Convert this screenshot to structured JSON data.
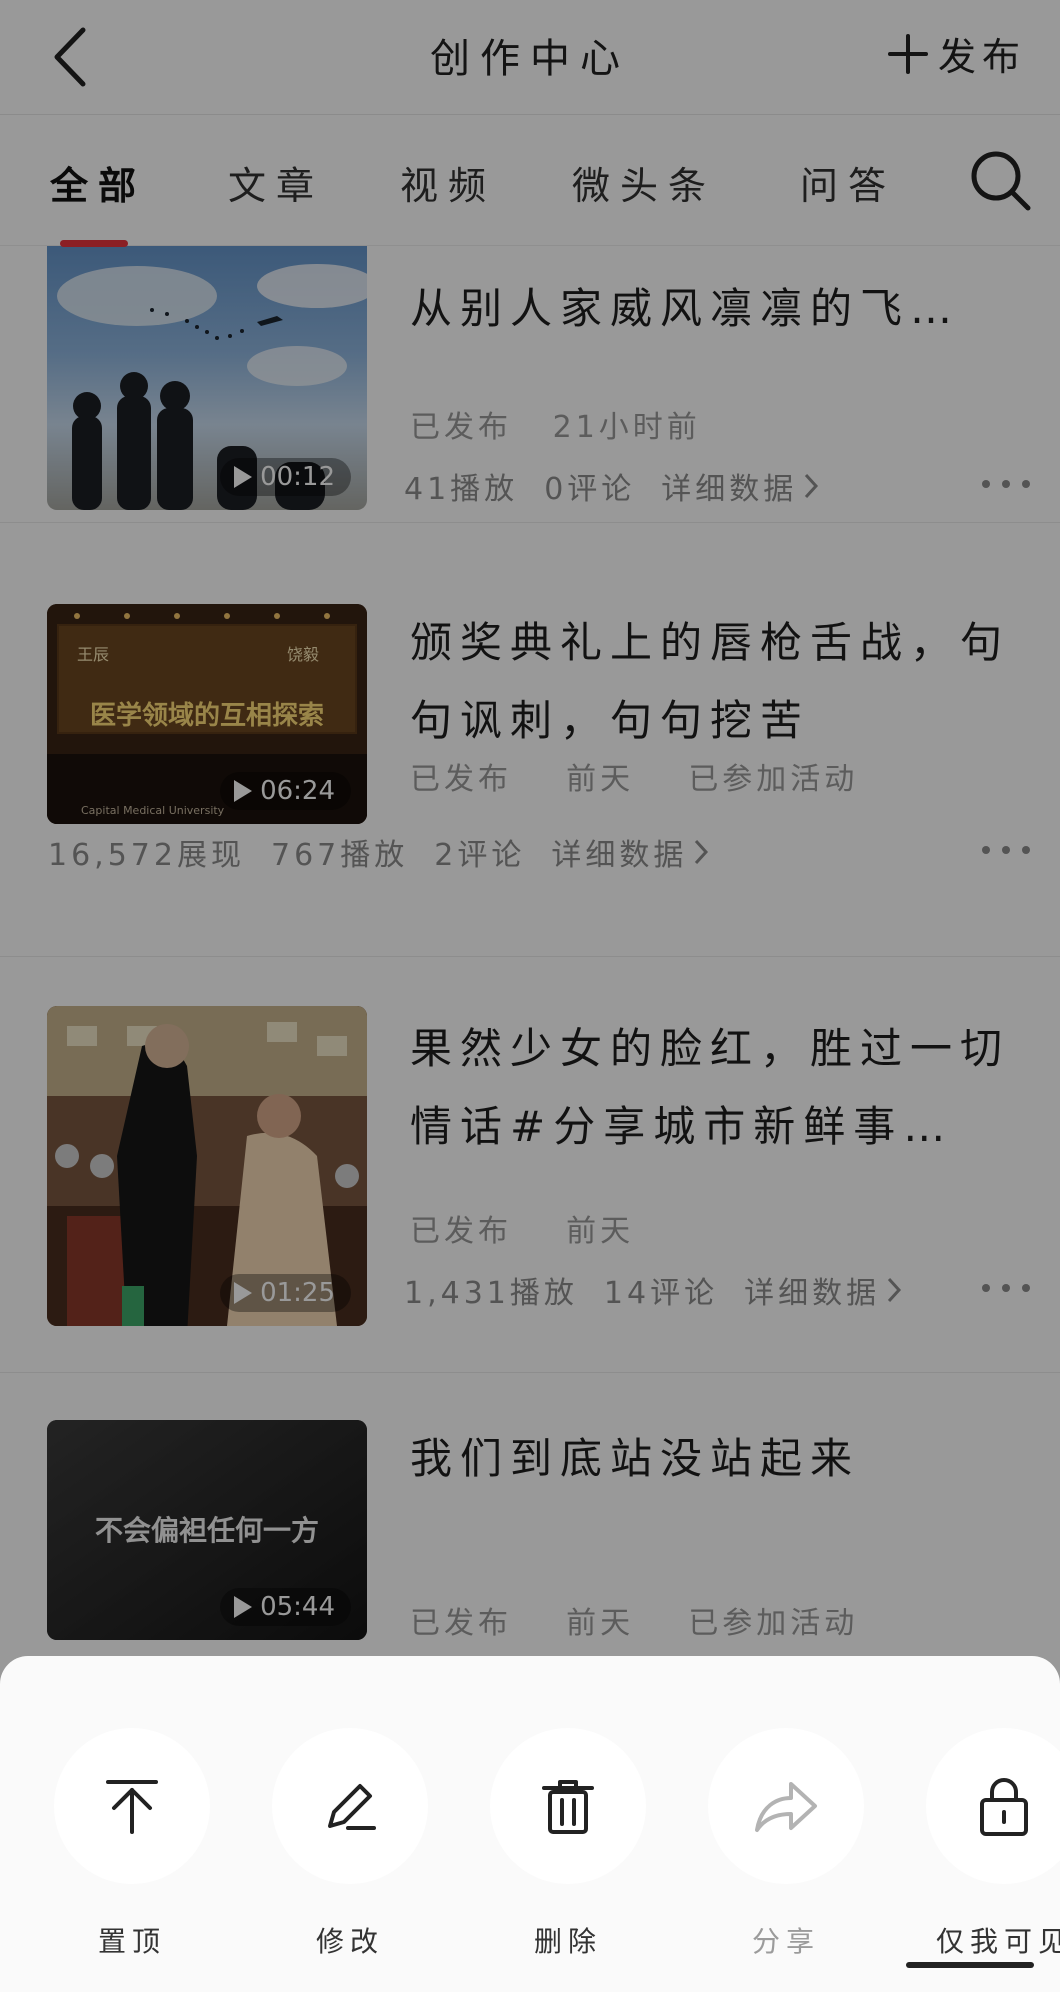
{
  "header": {
    "title": "创作中心",
    "publish_label": "发布"
  },
  "tabs": [
    {
      "label": "全部",
      "active": true
    },
    {
      "label": "文章",
      "active": false
    },
    {
      "label": "视频",
      "active": false
    },
    {
      "label": "微头条",
      "active": false
    },
    {
      "label": "问答",
      "active": false
    }
  ],
  "icons": {
    "back": "chevron-left-icon",
    "publish": "plus-icon",
    "search": "search-icon",
    "play": "play-icon",
    "detail": "chevron-right-icon",
    "more": "more-horizontal-icon"
  },
  "items": [
    {
      "title": "从别人家威风凛凛的飞…",
      "duration": "00:12",
      "status": "已发布",
      "time": "21小时前",
      "activity": "",
      "stats": {
        "impressions": "",
        "plays": "41播放",
        "comments": "0评论",
        "detail": "详细数据"
      }
    },
    {
      "title": "颁奖典礼上的唇枪舌战，句句讽刺，句句挖苦",
      "duration": "06:24",
      "status": "已发布",
      "time": "前天",
      "activity": "已参加活动",
      "stats": {
        "impressions": "16,572展现",
        "plays": "767播放",
        "comments": "2评论",
        "detail": "详细数据"
      }
    },
    {
      "title": "果然少女的脸红，胜过一切情话#分享城市新鲜事…",
      "duration": "01:25",
      "status": "已发布",
      "time": "前天",
      "activity": "",
      "stats": {
        "impressions": "",
        "plays": "1,431播放",
        "comments": "14评论",
        "detail": "详细数据"
      }
    },
    {
      "title": "我们到底站没站起来",
      "duration": "05:44",
      "status": "已发布",
      "time": "前天",
      "activity": "已参加活动",
      "stats": {
        "impressions": "",
        "plays": "",
        "comments": "",
        "detail": ""
      }
    }
  ],
  "thumb_text": {
    "item2_banner": "医学领域的互相探索",
    "item2_left_name": "王辰",
    "item2_right_name": "饶毅",
    "item2_caption": "Capital Medical University",
    "item4_caption": "不会偏袒任何一方"
  },
  "sheet": {
    "actions": [
      {
        "label": "置顶",
        "icon": "pin-top-icon",
        "enabled": true
      },
      {
        "label": "修改",
        "icon": "edit-pen-icon",
        "enabled": true
      },
      {
        "label": "删除",
        "icon": "trash-icon",
        "enabled": true
      },
      {
        "label": "分享",
        "icon": "share-arrow-icon",
        "enabled": false
      },
      {
        "label": "仅我可见",
        "icon": "lock-icon",
        "enabled": true
      }
    ]
  },
  "colors": {
    "accent": "#e8343d",
    "overlay": "rgba(0,0,0,0.40)",
    "sheet": "#fafafa"
  }
}
